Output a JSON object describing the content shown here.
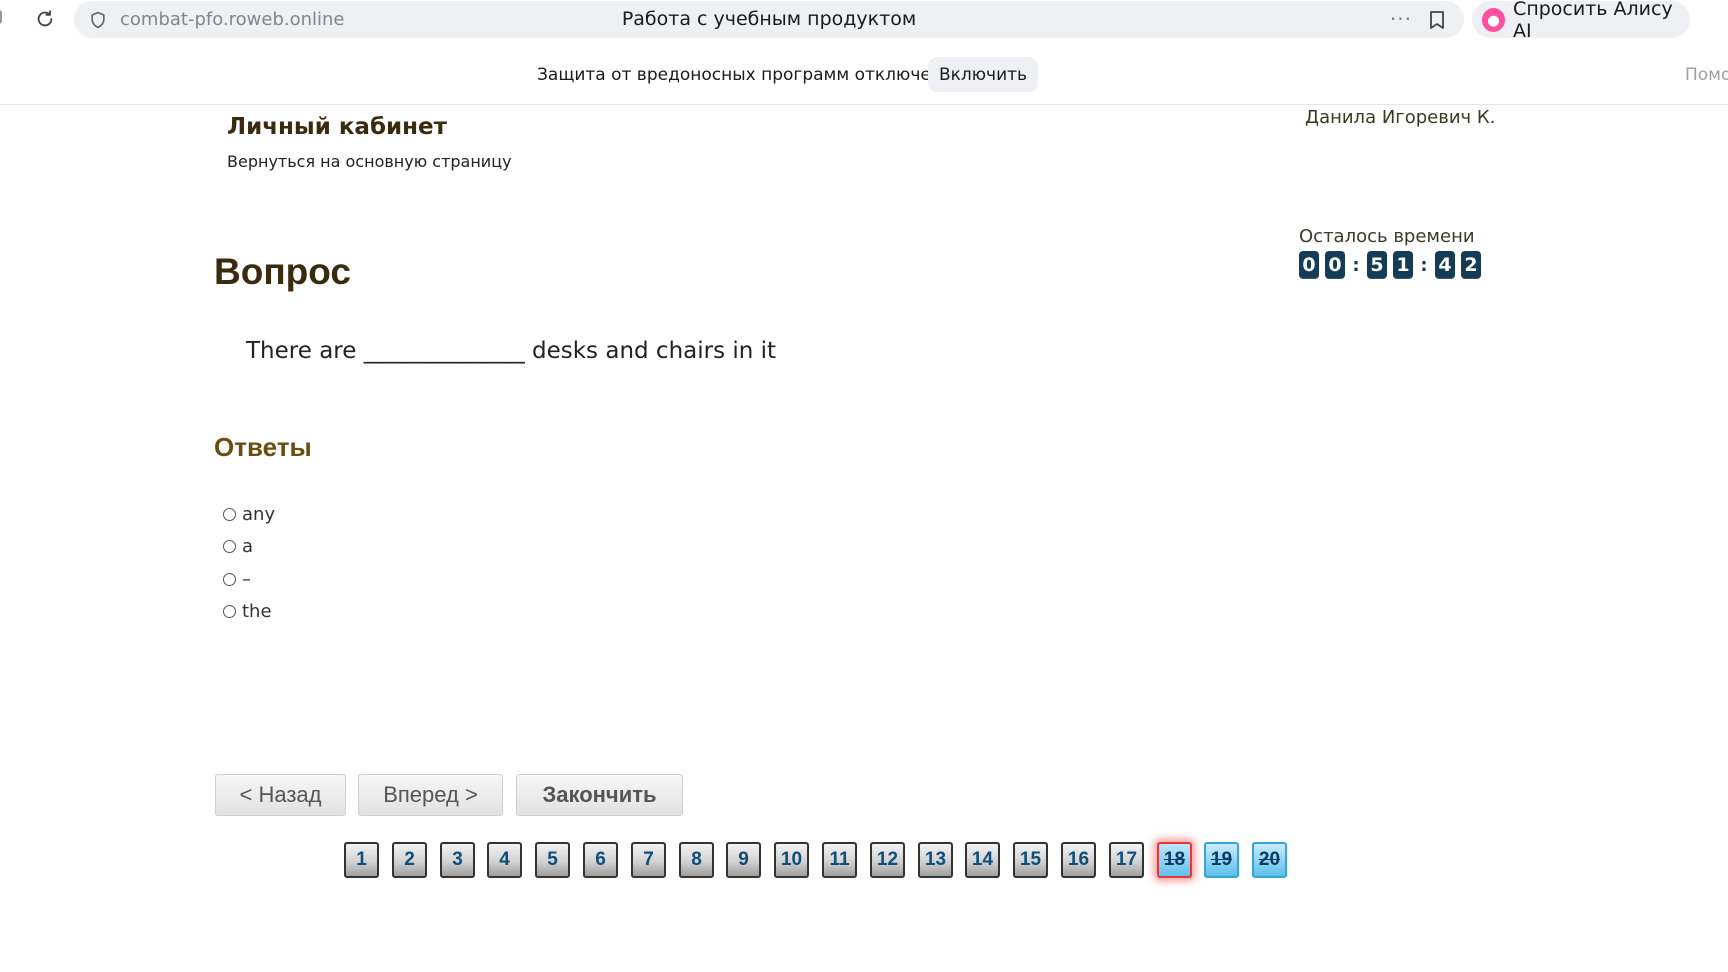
{
  "browser": {
    "url": "combat-pfo.roweb.online",
    "page_title": "Работа с учебным продуктом",
    "more_label": "···",
    "alice_label": "Спросить Алису AI"
  },
  "infobar": {
    "message": "Защита от вредоносных программ отключена",
    "enable_label": "Включить",
    "help_label": "Помо"
  },
  "header": {
    "cabinet_title": "Личный кабинет",
    "back_link": "Вернуться на основную страницу",
    "user_name": "Данила Игоревич К."
  },
  "timer": {
    "label": "Осталось времени",
    "h1": "0",
    "h2": "0",
    "m1": "5",
    "m2": "1",
    "s1": "4",
    "s2": "2",
    "sep": ":"
  },
  "question": {
    "heading": "Вопрос",
    "text": "There are ______________ desks and chairs in it"
  },
  "answers": {
    "heading": "Ответы",
    "options": [
      "any",
      "a",
      "–",
      "the"
    ]
  },
  "nav": {
    "prev_label": "< Назад",
    "next_label": "Вперед >",
    "finish_label": "Закончить"
  },
  "question_numbers": {
    "items": [
      "1",
      "2",
      "3",
      "4",
      "5",
      "6",
      "7",
      "8",
      "9",
      "10",
      "11",
      "12",
      "13",
      "14",
      "15",
      "16",
      "17",
      "18",
      "19",
      "20"
    ],
    "current": "18"
  }
}
